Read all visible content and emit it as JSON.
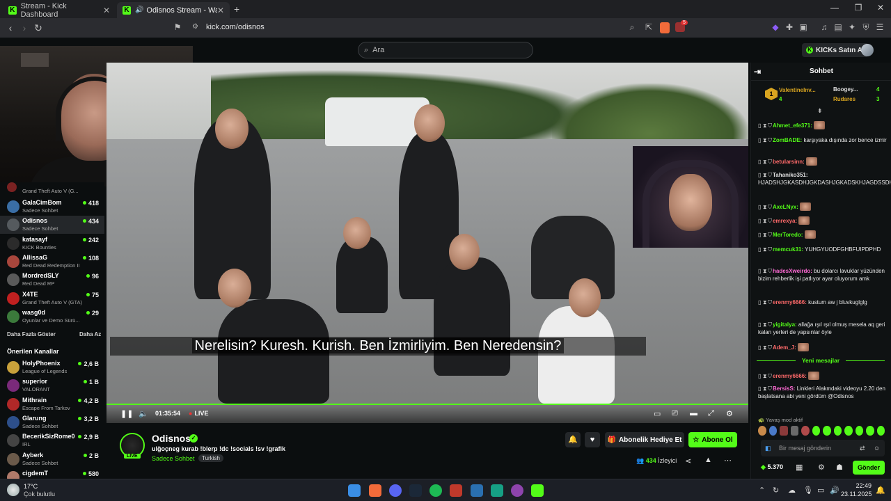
{
  "browser": {
    "tabs": [
      {
        "title": "Stream - Kick Dashboard",
        "active": false
      },
      {
        "title": "Odisnos Stream - Watch Live",
        "active": true
      }
    ],
    "url": "kick.com/odisnos",
    "brave_badge": "5"
  },
  "header": {
    "search_placeholder": "Ara",
    "kicks_button": "KICKs Satın Al"
  },
  "sidebar": {
    "channels": [
      {
        "name": "GalaCimBom",
        "category": "Sadece Sohbet",
        "viewers": "418",
        "color": "#3a6ea5"
      },
      {
        "name": "Odisnos",
        "category": "Sadece Sohbet",
        "viewers": "434",
        "color": "#555a5e",
        "selected": true
      },
      {
        "name": "katasayf",
        "category": "KICK Bounties",
        "viewers": "242",
        "color": "#2b2b2b"
      },
      {
        "name": "AllissaG",
        "category": "Red Dead Redemption II",
        "viewers": "108",
        "color": "#a8463c"
      },
      {
        "name": "MordredSLY",
        "category": "Red Dead RP",
        "viewers": "96",
        "color": "#5a5a5a"
      },
      {
        "name": "X4TE",
        "category": "Grand Theft Auto V (GTA)",
        "viewers": "75",
        "color": "#c02020"
      },
      {
        "name": "wasg0d",
        "category": "Oyunlar ve Demo Sürü...",
        "viewers": "29",
        "color": "#3b7a3b"
      }
    ],
    "partial_top": {
      "category": "Grand Theft Auto V (G..."
    },
    "show_more": "Daha Fazla Göster",
    "show_less": "Daha Az",
    "recommended_title": "Önerilen Kanallar",
    "recommended": [
      {
        "name": "HolyPhoenix",
        "category": "League of Legends",
        "viewers": "2,6 B",
        "color": "#c9a13b"
      },
      {
        "name": "superior",
        "category": "VALORANT",
        "viewers": "1 B",
        "color": "#7a2a7a"
      },
      {
        "name": "Mithrain",
        "category": "Escape From Tarkov",
        "viewers": "4,2 B",
        "color": "#b02828"
      },
      {
        "name": "Glarung",
        "category": "Sadece Sohbet",
        "viewers": "3,2 B",
        "color": "#2d4f8a"
      },
      {
        "name": "BecerikSizRome0",
        "category": "IRL",
        "viewers": "2,9 B",
        "color": "#444"
      },
      {
        "name": "Ayberk",
        "category": "Sadece Sohbet",
        "viewers": "2 B",
        "color": "#6b5a4a"
      },
      {
        "name": "cigdemT",
        "category": "",
        "viewers": "580",
        "color": "#b07a6a"
      }
    ]
  },
  "player": {
    "subtitle": "Nerelisin? Kuresh. Kurish. Ben İzmirliyim. Ben Neredensin?",
    "time": "01:35:54",
    "live_label": "LIVE"
  },
  "channel": {
    "name": "Odisnos",
    "live_badge": "LIVE",
    "stream_title": "ulğoçneg kurab !blerp !dc !socials !sv !grafik",
    "category": "Sadece Sohbet",
    "tag": "Turkish",
    "gift_button": "Abonelik Hediye Et",
    "subscribe_button": "Abone Ol",
    "viewers_count": "434",
    "viewers_label": "İzleyici"
  },
  "chat": {
    "title": "Sohbet",
    "leaderboard": [
      {
        "name": "ValentineInv...",
        "amount": "4"
      },
      {
        "name": "Boogey...",
        "amount": "4"
      },
      {
        "name": "Rudares",
        "amount": "3"
      }
    ],
    "messages": [
      {
        "user": "Ahmet_efe371:",
        "text": "",
        "color": "#53fc18",
        "emote": true
      },
      {
        "user": "ZomBADE:",
        "text": "karşıyaka dışında zor bence izmir",
        "color": "#53fc18"
      },
      {
        "user": "betularsinn:",
        "text": "",
        "color": "#ff6a6a",
        "emote": true
      },
      {
        "user": "Tahaniko351:",
        "text": "HJADSHJGKASDHJGKDASHJGKADSKHJAGDSSDH",
        "color": "#e0e0e0"
      },
      {
        "user": "AxeLNyx:",
        "text": "",
        "color": "#53fc18",
        "emote": true
      },
      {
        "user": "emrexya:",
        "text": "",
        "color": "#ff6a6a",
        "emote": true
      },
      {
        "user": "MerToredo:",
        "text": "",
        "color": "#53fc18",
        "emote": true
      },
      {
        "user": "memcuk31:",
        "text": "YUHGYUODFGHBFUIPDPHD",
        "color": "#53fc18"
      },
      {
        "user": "hadesXweirdo:",
        "text": "bu dolarcı lavuklar yüzünden bizim rehberlik işi patlıyor ayar oluyorum amk",
        "color": "#ff6ad5"
      },
      {
        "user": "erenmy6666:",
        "text": "kustum aw j bluvkuglglg",
        "color": "#ff6a6a"
      },
      {
        "user": "yigitalya:",
        "text": "allağa ışıl ışıl olmuş mesela aq geri kalan yerleri de yapsınlar öyle",
        "color": "#53fc18"
      },
      {
        "user": "Adem_J:",
        "text": "",
        "color": "#ff6a6a",
        "emote": true
      }
    ],
    "new_messages_label": "Yeni mesajlar",
    "after": [
      {
        "user": "erenmy6666:",
        "text": "",
        "color": "#ff6a6a",
        "emote": true
      },
      {
        "user": "BersisS:",
        "text": "Linkleri Alakmdaki videoyu 2.20 den başlatsana abi yeni gördüm @Odisnos",
        "color": "#ff6ad5"
      }
    ],
    "slow_mode": "Yavaş mod aktif",
    "input_placeholder": "Bir mesaj gönderin",
    "balance": "5.370",
    "send_button": "Gönder"
  },
  "taskbar": {
    "weather_temp": "17°C",
    "weather_desc": "Çok bulutlu",
    "time": "22:49",
    "date": "23.11.2025"
  }
}
